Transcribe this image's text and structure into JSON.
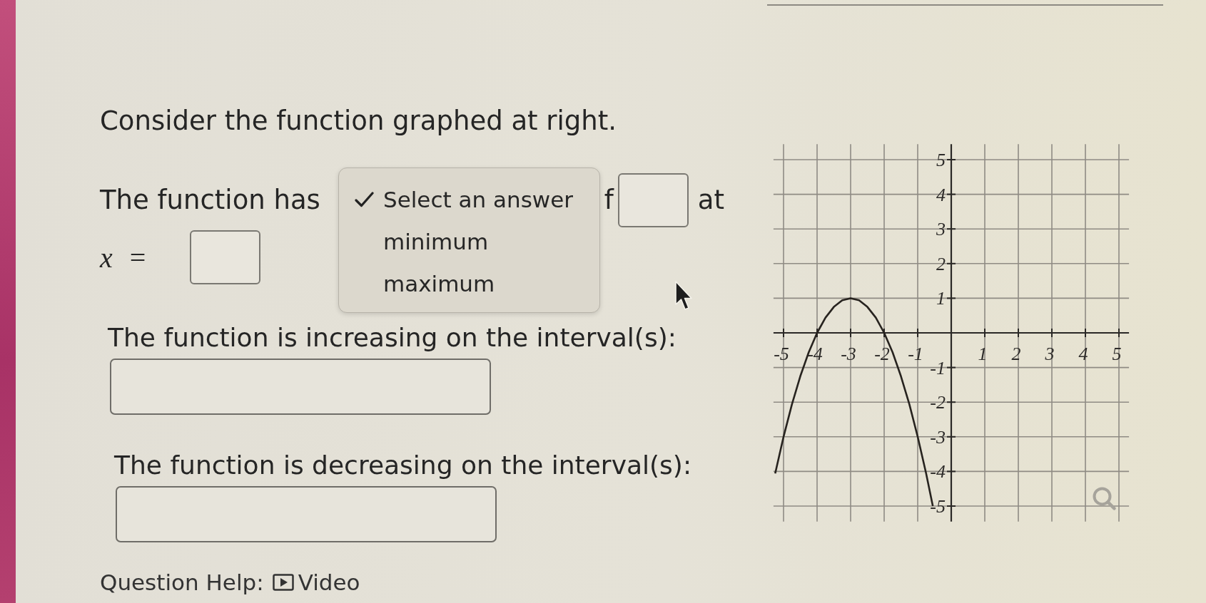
{
  "question": {
    "intro": "Consider the function graphed at right.",
    "extremum_lead": "The function has",
    "extremum_tail": "f",
    "extremum_at": "at",
    "x_equals": "*x* ="
  },
  "dropdown": {
    "options": [
      {
        "label": "Select an answer",
        "selected": true
      },
      {
        "label": "minimum",
        "selected": false
      },
      {
        "label": "maximum",
        "selected": false
      }
    ]
  },
  "increasing": {
    "prompt": "The function is increasing on the interval(s):"
  },
  "decreasing": {
    "prompt": "The function is decreasing on the interval(s):"
  },
  "graph": {
    "chart_data": {
      "type": "line",
      "grid": true,
      "x": [
        -5.25,
        -5,
        -4.75,
        -4.5,
        -4.25,
        -4,
        -3.75,
        -3.5,
        -3.25,
        -3,
        -2.75,
        -2.5,
        -2.25,
        -2,
        -1.75,
        -1.5,
        -1.25,
        -1,
        -0.75,
        -0.55
      ],
      "values": [
        -4.06,
        -3,
        -2.06,
        -1.25,
        -0.56,
        0,
        0.44,
        0.75,
        0.94,
        1,
        0.94,
        0.75,
        0.44,
        0,
        -0.56,
        -1.25,
        -2.06,
        -3,
        -4.06,
        -5
      ],
      "xlim": [
        -5.3,
        5.3
      ],
      "ylim": [
        -5.45,
        5.45
      ],
      "xticks": [
        -5,
        -4,
        -3,
        -2,
        -1,
        1,
        2,
        3,
        4,
        5
      ],
      "yticks": [
        5,
        4,
        3,
        2,
        1,
        -1,
        -2,
        -3,
        -4,
        -5
      ]
    }
  },
  "help": {
    "label": "Question Help:",
    "video": "Video"
  }
}
